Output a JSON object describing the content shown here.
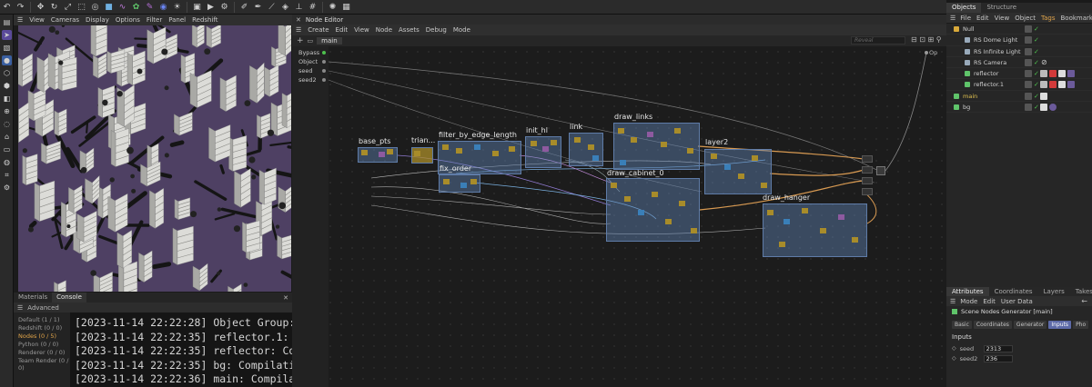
{
  "viewport": {
    "menu": [
      "View",
      "Cameras",
      "Display",
      "Options",
      "Filter",
      "Panel",
      "Redshift"
    ]
  },
  "console": {
    "tabs": [
      "Materials",
      "Console"
    ],
    "header": "Advanced",
    "categories": [
      "Default (1 / 1)",
      "Redshift (0 / 0)",
      "Nodes (0 / 5)",
      "Python (0 / 0)",
      "Renderer (0 / 0)",
      "Team Render (0 / 0)"
    ],
    "lines": [
      "[2023-11-14 22:22:28] Object Group:",
      "[2023-11-14 22:22:35] reflector.1: C",
      "[2023-11-14 22:22:35] reflector: Com",
      "[2023-11-14 22:22:35] bg: Compilatio",
      "[2023-11-14 22:22:36] main: Compilat"
    ]
  },
  "node_editor": {
    "title": "Node Editor",
    "menu": [
      "Create",
      "Edit",
      "View",
      "Node",
      "Assets",
      "Debug",
      "Mode"
    ],
    "tab": "main",
    "search_placeholder": "Reveal",
    "inputs": [
      "Bypass",
      "Object",
      "seed",
      "seed2"
    ],
    "output_label": "Op",
    "groups": [
      "base_pts",
      "trian...",
      "filter_by_edge_length",
      "fix_order",
      "init_hl",
      "link",
      "draw_links",
      "draw_cabinet_0",
      "layer2",
      "draw_hanger"
    ]
  },
  "objects_panel": {
    "tabs": [
      "Objects",
      "Structure"
    ],
    "menu": [
      "File",
      "Edit",
      "View",
      "Object",
      "Tags",
      "Bookmarks"
    ],
    "items": [
      "Null",
      "RS Dome Light",
      "RS Infinite Light",
      "RS Camera",
      "reflector",
      "reflector.1",
      "main",
      "bg"
    ]
  },
  "attributes": {
    "tabs": [
      "Attributes",
      "Coordinates",
      "Layers",
      "Takes"
    ],
    "menu": [
      "Mode",
      "Edit",
      "User Data"
    ],
    "object_title": "Scene Nodes Generator [main]",
    "subtabs": [
      "Basic",
      "Coordinates",
      "Generator",
      "Inputs",
      "Pho"
    ],
    "section": "Inputs",
    "fields": [
      {
        "label": "seed",
        "value": "2313"
      },
      {
        "label": "seed2",
        "value": "236"
      }
    ]
  },
  "colors": {
    "accent": "#5d6aa8",
    "viewport_bg": "#4e4063",
    "group_fill": "#6082b4",
    "wire_orange": "#d89a52",
    "active_category": "#e0a44a"
  }
}
